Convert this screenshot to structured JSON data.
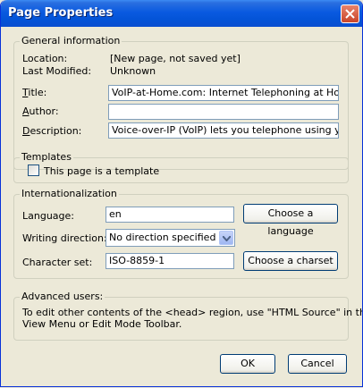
{
  "window": {
    "title": "Page Properties"
  },
  "general": {
    "legend": "General information",
    "location_label": "Location:",
    "location_value": "[New page, not saved yet]",
    "modified_label": "Last Modified:",
    "modified_value": "Unknown",
    "title_label_u": "T",
    "title_label_rest": "itle:",
    "title_value": "VoIP-at-Home.com: Internet Telephoning at Home",
    "author_label_u": "A",
    "author_label_rest": "uthor:",
    "author_value": "",
    "description_label_u": "D",
    "description_label_rest": "escription:",
    "description_value": "Voice-over-IP (VoIP) lets you telephone using your Ir"
  },
  "templates": {
    "legend": "Templates",
    "checkbox_label": "This page is a template",
    "checked": false
  },
  "i18n": {
    "legend": "Internationalization",
    "language_label": "Language:",
    "language_value": "en",
    "choose_language": "Choose a language",
    "direction_label": "Writing direction:",
    "direction_value": "No direction specified",
    "charset_label": "Character set:",
    "charset_value": "ISO-8859-1",
    "choose_charset": "Choose a charset"
  },
  "advanced": {
    "legend": "Advanced users:",
    "text_line1": "To edit other contents of the <head> region, use \"HTML Source\" in the",
    "text_line2": "View Menu or Edit Mode Toolbar."
  },
  "footer": {
    "ok": "OK",
    "cancel": "Cancel"
  }
}
